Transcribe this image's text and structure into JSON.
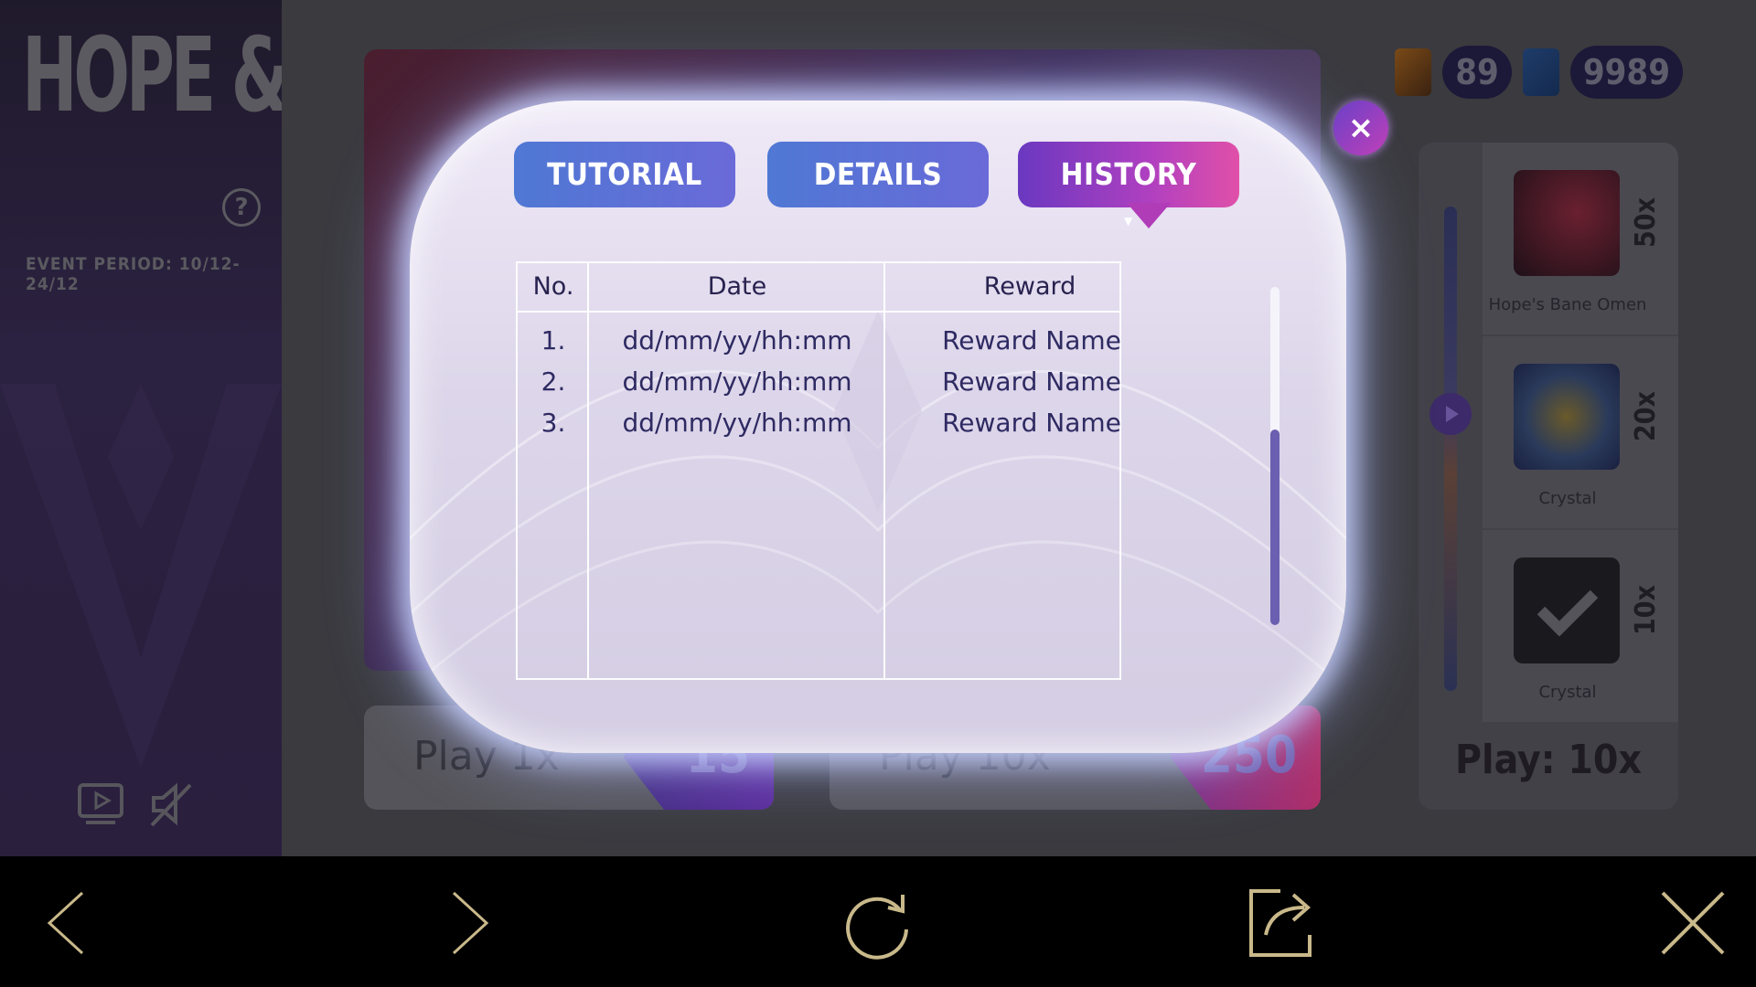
{
  "event": {
    "title": "HOPE & DOOM",
    "period": "EVENT PERIOD: 10/12-24/12",
    "help_icon": "?"
  },
  "currency": [
    {
      "icon": "ticket-icon",
      "amount": "89"
    },
    {
      "icon": "crystal-gem-icon",
      "amount": "9989"
    }
  ],
  "rewards": [
    {
      "name": "Hope's Bane Omen",
      "multiplier": "50x",
      "icon": "hopes-bane-omen-icon"
    },
    {
      "name": "Crystal",
      "multiplier": "20x",
      "icon": "crystal-icon"
    },
    {
      "name": "Crystal",
      "multiplier": "10x",
      "icon": "check-crystal-icon"
    }
  ],
  "play_count": "Play: 10x",
  "play_buttons": [
    {
      "label": "Play 1x",
      "cost": "15"
    },
    {
      "label": "Play 10x",
      "cost": "250"
    }
  ],
  "modal": {
    "tabs": [
      "TUTORIAL",
      "DETAILS",
      "HISTORY"
    ],
    "active_tab": "HISTORY",
    "close_icon": "×",
    "table": {
      "headers": [
        "No.",
        "Date",
        "Reward"
      ],
      "rows": [
        {
          "no": "1.",
          "date": "dd/mm/yy/hh:mm",
          "reward": "Reward Name"
        },
        {
          "no": "2.",
          "date": "dd/mm/yy/hh:mm",
          "reward": "Reward Name"
        },
        {
          "no": "3.",
          "date": "dd/mm/yy/hh:mm",
          "reward": "Reward Name"
        }
      ]
    }
  },
  "browser_bar": {
    "icons": [
      "back-arrow-icon",
      "forward-arrow-icon",
      "reload-icon",
      "share-icon",
      "close-icon"
    ]
  },
  "colors": {
    "accent_blue": "#4f78d4",
    "accent_purple": "#6a38c0",
    "accent_pink": "#e050a8",
    "browser_icon": "#c9b98a"
  }
}
